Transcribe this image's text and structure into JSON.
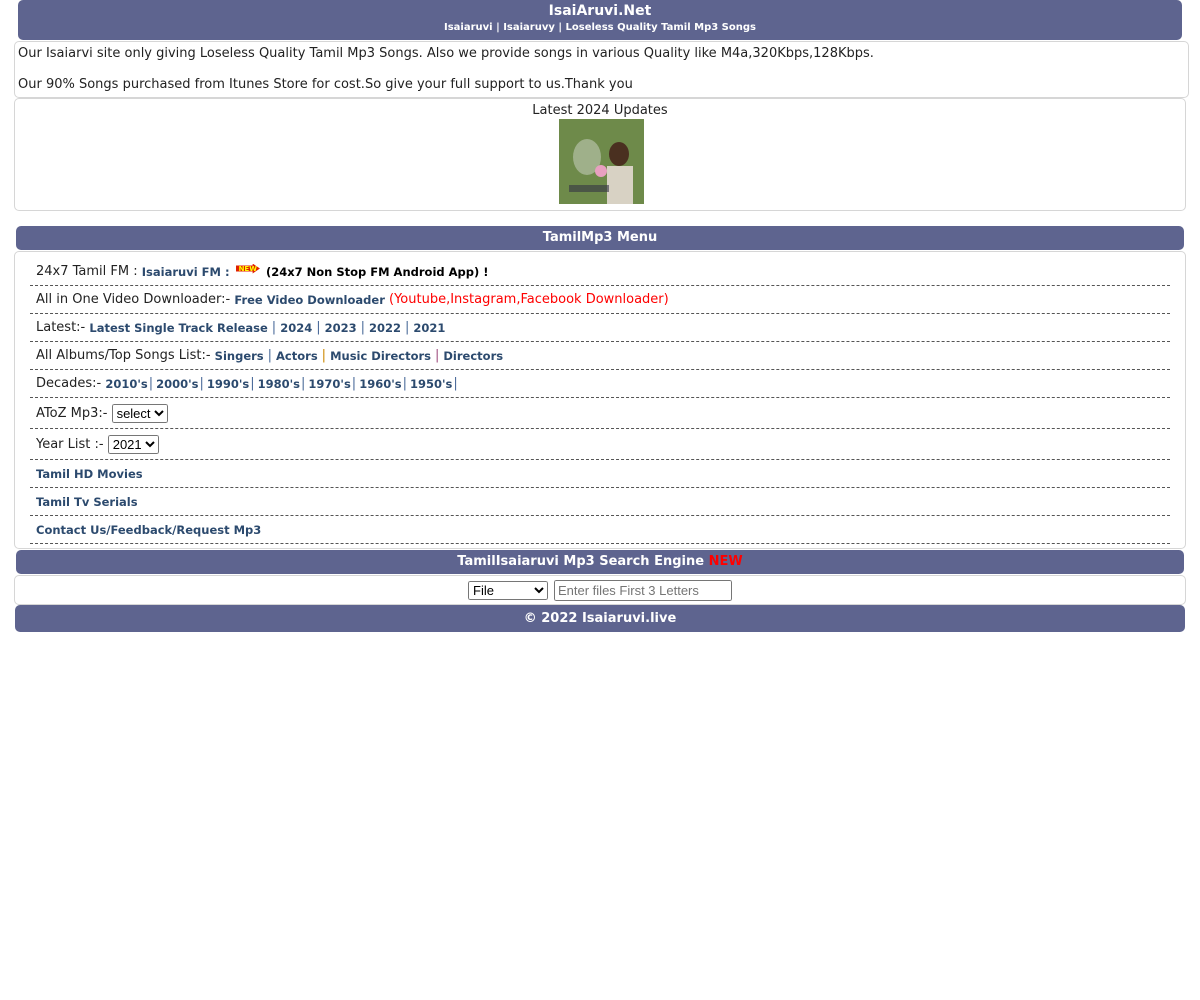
{
  "header": {
    "title": "IsaiAruvi.Net",
    "subtitle": "Isaiaruvi | Isaiaruvy | Loseless Quality Tamil Mp3 Songs"
  },
  "info": {
    "line1": "Our Isaiarvi site only giving Loseless Quality Tamil Mp3 Songs. Also we provide songs in various Quality like M4a,320Kbps,128Kbps.",
    "line2": "Our 90% Songs purchased from Itunes Store for cost.So give your full support to us.Thank you"
  },
  "updates": {
    "title": "Latest 2024 Updates"
  },
  "menu": {
    "title": "TamilMp3 Menu",
    "fm": {
      "label": "24x7 Tamil FM : ",
      "link": "Isaiaruvi FM :",
      "badge": "NEW",
      "app": "(24x7 Non Stop FM Android App) !"
    },
    "video": {
      "label": "All in One Video Downloader:- ",
      "link": "Free Video Downloader",
      "note": " (Youtube,Instagram,Facebook Downloader)"
    },
    "latest": {
      "label": "Latest:- ",
      "links": [
        "Latest Single Track Release",
        "2024",
        "2023",
        "2022",
        "2021"
      ]
    },
    "albums": {
      "label": "All Albums/Top Songs List:- ",
      "links": [
        "Singers",
        "Actors",
        "Music Directors",
        "Directors"
      ]
    },
    "decades": {
      "label": "Decades:- ",
      "links": [
        "2010's",
        "2000's",
        "1990's",
        "1980's",
        "1970's",
        "1960's",
        "1950's"
      ]
    },
    "atoz": {
      "label": "AToZ Mp3:- ",
      "selected": "select"
    },
    "year": {
      "label": "Year List :- ",
      "selected": "2021"
    },
    "links": [
      "Tamil HD Movies",
      "Tamil Tv Serials",
      "Contact Us/Feedback/Request Mp3"
    ]
  },
  "search": {
    "title": "TamilIsaiaruvi Mp3 Search Engine",
    "badge": "NEW",
    "type": "File",
    "placeholder": "Enter files First 3 Letters"
  },
  "footer": {
    "text": "© 2022 Isaiaruvi.live"
  },
  "colors": {
    "bar": "#5e648f",
    "link": "#2c4a6e",
    "red": "#ff0000"
  }
}
